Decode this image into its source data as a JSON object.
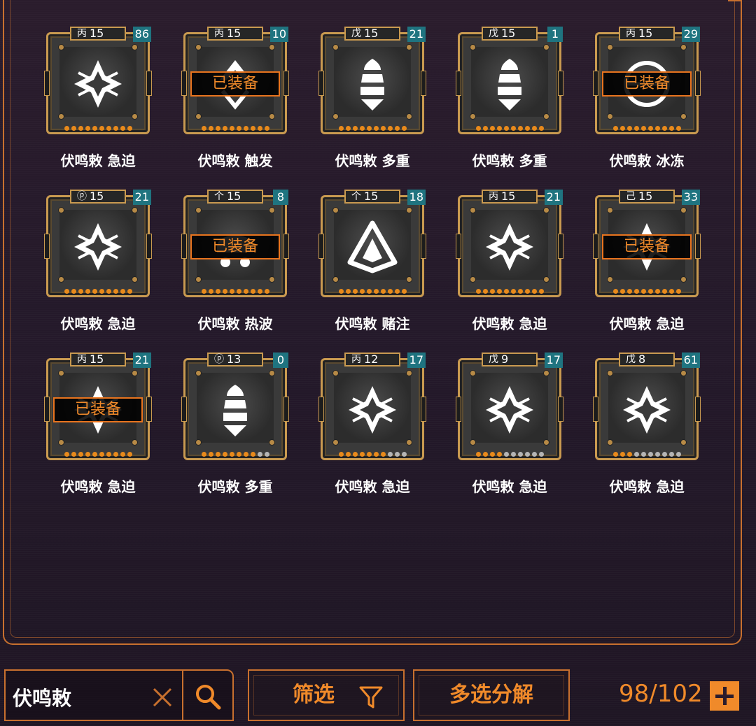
{
  "items": [
    {
      "glyph": "丙",
      "level": "15",
      "count": "86",
      "name": "伏鸣敕 急迫",
      "equipped": false,
      "icon": "star-emblem-icon",
      "rank": 10
    },
    {
      "glyph": "丙",
      "level": "15",
      "count": "10",
      "name": "伏鸣敕 触发",
      "equipped": true,
      "icon": "trigger-emblem-icon",
      "rank": 10
    },
    {
      "glyph": "戊",
      "level": "15",
      "count": "21",
      "name": "伏鸣敕 多重",
      "equipped": false,
      "icon": "bullet-emblem-icon",
      "rank": 10
    },
    {
      "glyph": "戊",
      "level": "15",
      "count": "1",
      "name": "伏鸣敕 多重",
      "equipped": false,
      "icon": "bullet-emblem-icon",
      "rank": 10
    },
    {
      "glyph": "丙",
      "level": "15",
      "count": "29",
      "name": "伏鸣敕 冰冻",
      "equipped": true,
      "icon": "frost-emblem-icon",
      "rank": 10
    },
    {
      "glyph": "ⓟ",
      "level": "15",
      "count": "21",
      "name": "伏鸣敕 急迫",
      "equipped": false,
      "icon": "star-emblem-icon",
      "rank": 10
    },
    {
      "glyph": "个",
      "level": "15",
      "count": "8",
      "name": "伏鸣敕 热波",
      "equipped": true,
      "icon": "heatwave-emblem-icon",
      "rank": 10
    },
    {
      "glyph": "个",
      "level": "15",
      "count": "18",
      "name": "伏鸣敕 赌注",
      "equipped": false,
      "icon": "wager-emblem-icon",
      "rank": 10
    },
    {
      "glyph": "丙",
      "level": "15",
      "count": "21",
      "name": "伏鸣敕 急迫",
      "equipped": false,
      "icon": "star-emblem-icon",
      "rank": 10
    },
    {
      "glyph": "己",
      "level": "15",
      "count": "33",
      "name": "伏鸣敕 急迫",
      "equipped": true,
      "icon": "star-emblem-icon",
      "rank": 10
    },
    {
      "glyph": "丙",
      "level": "15",
      "count": "21",
      "name": "伏鸣敕 急迫",
      "equipped": true,
      "icon": "star-emblem-icon",
      "rank": 10
    },
    {
      "glyph": "ⓟ",
      "level": "13",
      "count": "0",
      "name": "伏鸣敕 多重",
      "equipped": false,
      "icon": "bullet-emblem-icon",
      "rank": 8
    },
    {
      "glyph": "丙",
      "level": "12",
      "count": "17",
      "name": "伏鸣敕 急迫",
      "equipped": false,
      "icon": "star-emblem-icon",
      "rank": 7
    },
    {
      "glyph": "戊",
      "level": "9",
      "count": "17",
      "name": "伏鸣敕 急迫",
      "equipped": false,
      "icon": "star-emblem-icon",
      "rank": 4
    },
    {
      "glyph": "戊",
      "level": "8",
      "count": "61",
      "name": "伏鸣敕 急迫",
      "equipped": false,
      "icon": "star-emblem-icon",
      "rank": 3
    }
  ],
  "equipped_label": "已装备",
  "max_rank": 10,
  "search": {
    "value": "伏鸣敕"
  },
  "filter_label": "筛选",
  "multi_decompose_label": "多选分解",
  "inventory_count": "98/102",
  "colors": {
    "accent": "#f08a2a",
    "frame": "#c99a50",
    "count_badge": "#1f7480",
    "dot_off": "#b5b5b5"
  }
}
